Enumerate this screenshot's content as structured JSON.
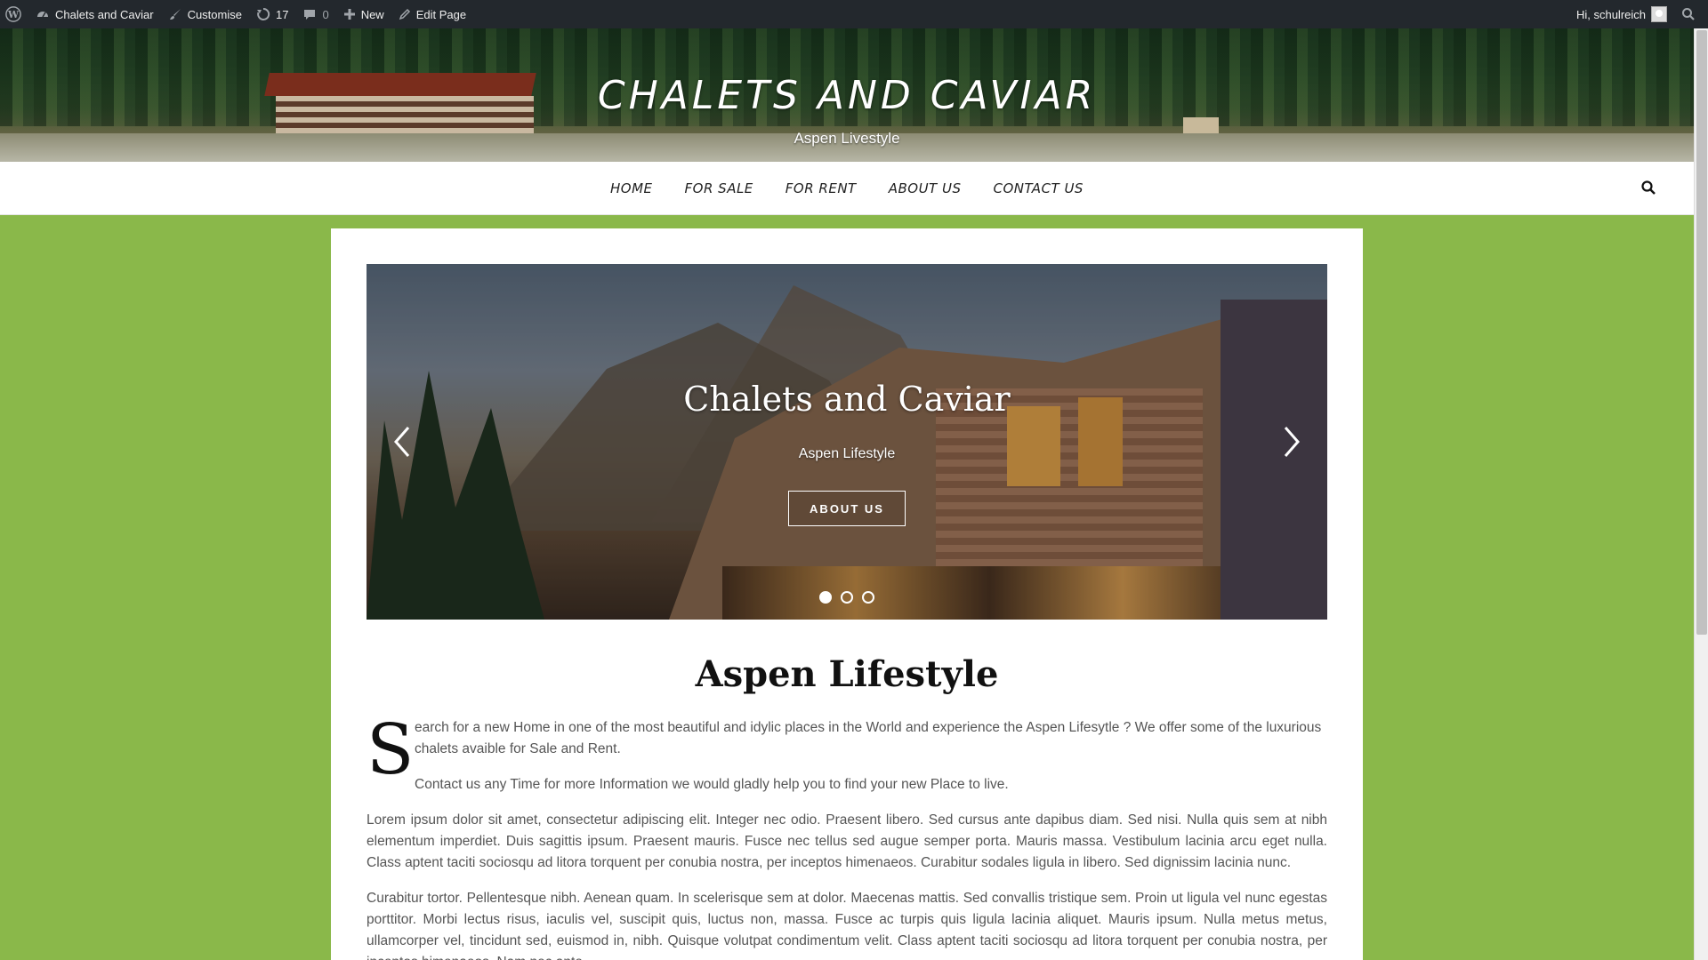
{
  "adminbar": {
    "site_name": "Chalets and Caviar",
    "customise": "Customise",
    "updates_count": "17",
    "comments_count": "0",
    "new": "New",
    "edit_page": "Edit Page",
    "greeting": "Hi, schulreich"
  },
  "header": {
    "title": "CHALETS AND CAVIAR",
    "tagline": "Aspen Livestyle"
  },
  "nav": {
    "items": [
      "HOME",
      "FOR SALE",
      "FOR RENT",
      "ABOUT US",
      "CONTACT US"
    ]
  },
  "slider": {
    "title": "Chalets and Caviar",
    "subtitle": "Aspen Lifestyle",
    "button": "ABOUT US",
    "slides": 3,
    "active_slide": 1
  },
  "article": {
    "title": "Aspen Lifestyle",
    "dropcap": "S",
    "p1": "earch for a new Home in one of the most beautiful and idylic places in the World and experience the Aspen Lifesytle ? We offer some of the luxurious chalets avaible for Sale and Rent.",
    "p2": "Contact us any Time for more Information we would gladly help you to find your new Place to live.",
    "p3": "Lorem ipsum dolor sit amet, consectetur adipiscing elit. Integer nec odio. Praesent libero. Sed cursus ante dapibus diam. Sed nisi. Nulla quis sem at nibh elementum imperdiet. Duis sagittis ipsum. Praesent mauris. Fusce nec tellus sed augue semper porta. Mauris massa. Vestibulum lacinia arcu eget nulla. Class aptent taciti sociosqu ad litora torquent per conubia nostra, per inceptos himenaeos. Curabitur sodales ligula in libero. Sed dignissim lacinia nunc.",
    "p4": "Curabitur tortor. Pellentesque nibh. Aenean quam. In scelerisque sem at dolor. Maecenas mattis. Sed convallis tristique sem. Proin ut ligula vel nunc egestas porttitor. Morbi lectus risus, iaculis vel, suscipit quis, luctus non, massa. Fusce ac turpis quis ligula lacinia aliquet. Mauris ipsum. Nulla metus metus, ullamcorper vel, tincidunt sed, euismod in, nibh. Quisque volutpat condimentum velit. Class aptent taciti sociosqu ad litora torquent per conubia nostra, per inceptos himenaeos. Nam nec ante."
  },
  "colors": {
    "page_bg": "#8ab84a",
    "adminbar_bg": "#23282d"
  }
}
